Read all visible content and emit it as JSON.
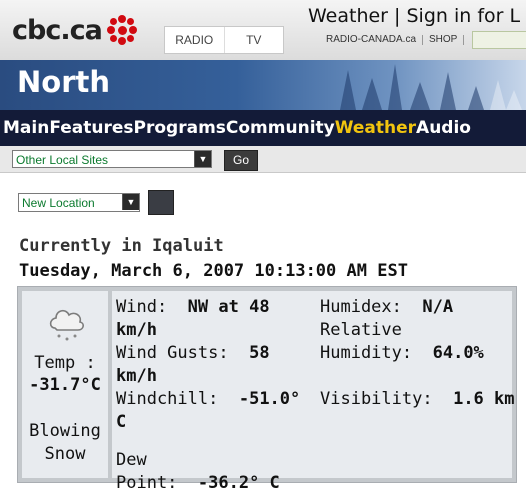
{
  "header": {
    "logo_text": "cbc.ca",
    "tabs": [
      "RADIO",
      "TV"
    ],
    "title_strip": "Weather | Sign in for L",
    "top_links": [
      "RADIO-CANADA.ca",
      "SHOP"
    ],
    "region": "North"
  },
  "nav": {
    "items": [
      "Main",
      "Features",
      "Programs",
      "Community",
      "Weather",
      "Audio"
    ],
    "active": "Weather"
  },
  "subnav": {
    "sites_select": "Other Local Sites",
    "go_label": "Go"
  },
  "location_select": "New Location",
  "current": {
    "heading": "Currently in Iqaluit",
    "datetime": "Tuesday, March 6, 2007 10:13:00 AM EST",
    "temp_label": "Temp :",
    "temp_value": "-31.7°C",
    "condition_line1": "Blowing",
    "condition_line2": "Snow",
    "condition_icon": "cloud-snow-icon",
    "wind_label": "Wind:",
    "wind_value_a": "NW at 48",
    "wind_value_b": "km/h",
    "gust_label": "Wind Gusts:",
    "gust_value": "58",
    "gust_unit": "km/h",
    "windchill_label": "Windchill:",
    "windchill_value": "-51.0° C",
    "dew_label_a": "Dew",
    "dew_label_b": "Point:",
    "dew_value": "-36.2° C",
    "humidex_label": "Humidex:",
    "humidex_value": "N/A",
    "humidity_label_a": "Relative",
    "humidity_label_b": "Humidity:",
    "humidity_value": "64.0%",
    "visibility_label": "Visibility:",
    "visibility_value": "1.6  km"
  }
}
